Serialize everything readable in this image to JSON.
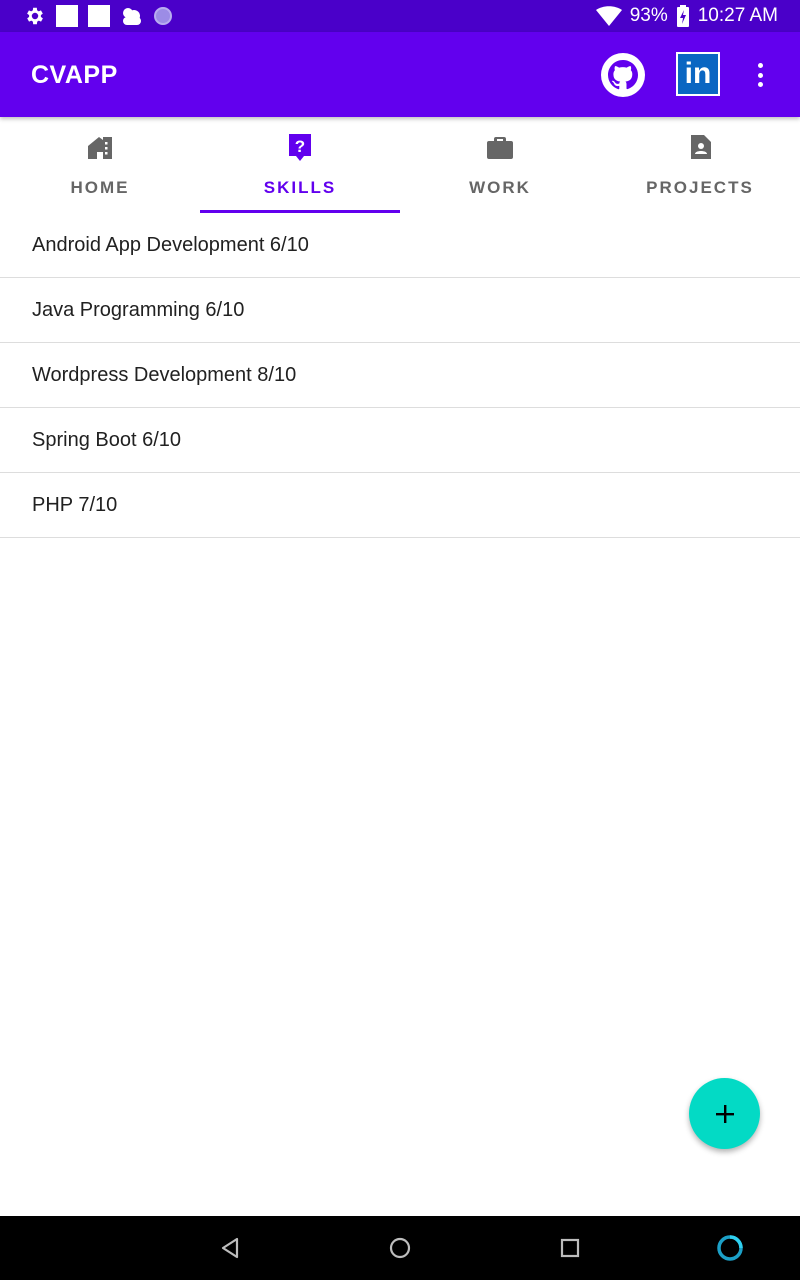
{
  "status_bar": {
    "battery": "93%",
    "time": "10:27 AM",
    "icons": [
      "settings-icon",
      "notification-square-icon",
      "notification-square-icon",
      "cloud-icon",
      "circle-icon",
      "wifi-icon",
      "battery-charging-icon"
    ]
  },
  "app_bar": {
    "title": "CVAPP",
    "actions": [
      "github-icon",
      "linkedin-icon",
      "more-vert-icon"
    ],
    "linkedin_text": "in"
  },
  "tabs": [
    {
      "label": "HOME",
      "icon": "home-icon",
      "active": false
    },
    {
      "label": "SKILLS",
      "icon": "help-icon",
      "active": true
    },
    {
      "label": "WORK",
      "icon": "briefcase-icon",
      "active": false
    },
    {
      "label": "PROJECTS",
      "icon": "document-icon",
      "active": false
    }
  ],
  "skills": [
    "Android App Development 6/10",
    "Java Programming 6/10",
    "Wordpress Development 8/10",
    "Spring Boot 6/10",
    "PHP 7/10"
  ],
  "fab": {
    "icon": "add-icon"
  },
  "nav_bar": {
    "icons": [
      "back-icon",
      "home-circle-icon",
      "recents-icon",
      "assistant-icon"
    ]
  },
  "colors": {
    "primary": "#6200ee",
    "status_bar": "#4a00c9",
    "accent": "#03dac5",
    "tab_inactive": "#666666"
  }
}
